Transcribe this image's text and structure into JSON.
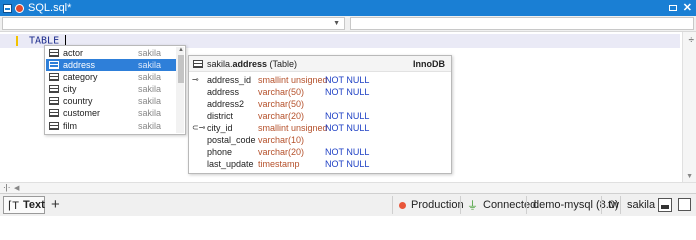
{
  "window": {
    "title": "SQL.sql*",
    "maximize_icon": "maximize-icon",
    "close_icon": "close-icon",
    "close_glyph": "✕"
  },
  "toolbar": {
    "combo_left_value": "",
    "combo_right_value": ""
  },
  "editor": {
    "code": "TABLE_"
  },
  "autocomplete": {
    "items": [
      {
        "name": "actor",
        "schema": "sakila",
        "selected": false
      },
      {
        "name": "address",
        "schema": "sakila",
        "selected": true
      },
      {
        "name": "category",
        "schema": "sakila",
        "selected": false
      },
      {
        "name": "city",
        "schema": "sakila",
        "selected": false
      },
      {
        "name": "country",
        "schema": "sakila",
        "selected": false
      },
      {
        "name": "customer",
        "schema": "sakila",
        "selected": false
      },
      {
        "name": "film",
        "schema": "sakila",
        "selected": false
      }
    ]
  },
  "detail": {
    "schema_prefix": "sakila.",
    "table_name": "address",
    "table_kind": " (Table)",
    "engine": "InnoDB",
    "columns": [
      {
        "key": "⊸",
        "name": "address_id",
        "type": "smallint unsigned",
        "nullability": "NOT NULL"
      },
      {
        "key": "",
        "name": "address",
        "type": "varchar(50)",
        "nullability": "NOT NULL"
      },
      {
        "key": "",
        "name": "address2",
        "type": "varchar(50)",
        "nullability": ""
      },
      {
        "key": "",
        "name": "district",
        "type": "varchar(20)",
        "nullability": "NOT NULL"
      },
      {
        "key": "⊂⊸",
        "name": "city_id",
        "type": "smallint unsigned",
        "nullability": "NOT NULL"
      },
      {
        "key": "",
        "name": "postal_code",
        "type": "varchar(10)",
        "nullability": ""
      },
      {
        "key": "",
        "name": "phone",
        "type": "varchar(20)",
        "nullability": "NOT NULL"
      },
      {
        "key": "",
        "name": "last_update",
        "type": "timestamp",
        "nullability": "NOT NULL"
      }
    ]
  },
  "statusbar": {
    "text_tab_label": "Text",
    "add_label": "+",
    "environment": "Production",
    "connection_status": "Connected.",
    "connection_name": "demo-mysql (8.0)",
    "user": "tw",
    "database": "sakila"
  },
  "colors": {
    "titlebar": "#1a7fd4",
    "selection": "#2e7fd9",
    "type_text": "#b5512b",
    "null_text": "#1d3fc4",
    "production_dot": "#e8563a",
    "connected_icon": "#3a9a2a"
  }
}
